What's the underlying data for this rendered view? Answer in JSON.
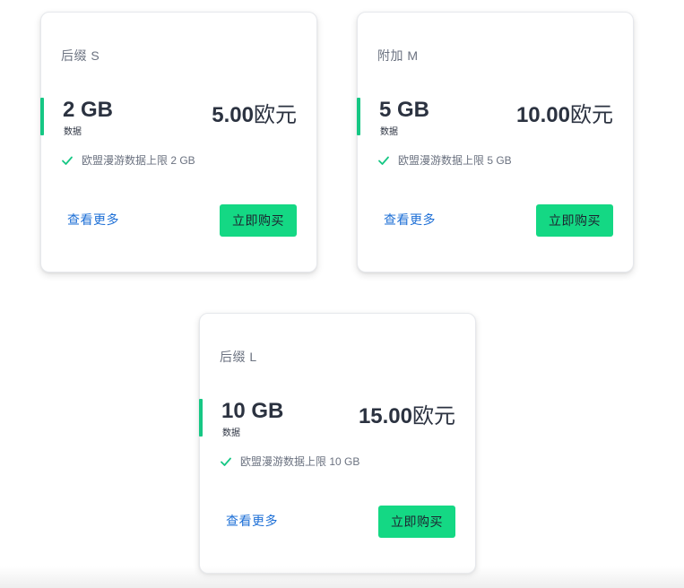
{
  "colors": {
    "accent": "#16c784",
    "button": "#14d884",
    "link": "#1d6fd6",
    "text": "#2b3240",
    "muted": "#6b7280"
  },
  "plans": [
    {
      "name": "后缀 S",
      "data_amount": "2 GB",
      "data_label": "数据",
      "price_value": "5.00",
      "price_unit": "欧元",
      "feature_icon": "check-icon",
      "feature": "欧盟漫游数据上限 2 GB",
      "more_label": "查看更多",
      "buy_label": "立即购买"
    },
    {
      "name": "附加 M",
      "data_amount": "5 GB",
      "data_label": "数据",
      "price_value": "10.00",
      "price_unit": "欧元",
      "feature_icon": "check-icon",
      "feature": "欧盟漫游数据上限 5 GB",
      "more_label": "查看更多",
      "buy_label": "立即购买"
    },
    {
      "name": "后缀 L",
      "data_amount": "10 GB",
      "data_label": "数据",
      "price_value": "15.00",
      "price_unit": "欧元",
      "feature_icon": "check-icon",
      "feature": "欧盟漫游数据上限 10 GB",
      "more_label": "查看更多",
      "buy_label": "立即购买"
    }
  ]
}
